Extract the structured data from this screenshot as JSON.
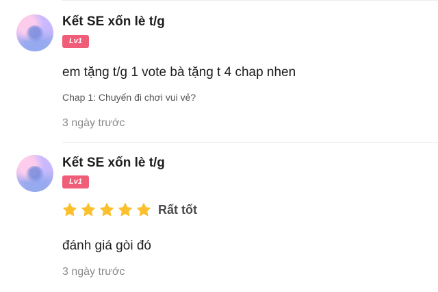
{
  "comments": [
    {
      "username": "Kết SE xốn lè t/g",
      "level": "Lv1",
      "text": "em tặng t/g 1 vote bà tặng t 4 chap nhen",
      "chapter": "Chap 1: Chuyến đi chơi vui vẻ?",
      "time": "3 ngày trước"
    },
    {
      "username": "Kết SE xốn lè t/g",
      "level": "Lv1",
      "rating": {
        "stars": 5,
        "max": 5,
        "label": "Rất tốt"
      },
      "text": "đánh giá gòi đó",
      "time": "3 ngày trước"
    }
  ],
  "colors": {
    "level_badge": "#ef5d78",
    "star": "#fbc02d",
    "timestamp": "#8a8a8a"
  },
  "icons": {
    "avatar": "pastel-cloud-avatar",
    "star": "star-icon"
  }
}
